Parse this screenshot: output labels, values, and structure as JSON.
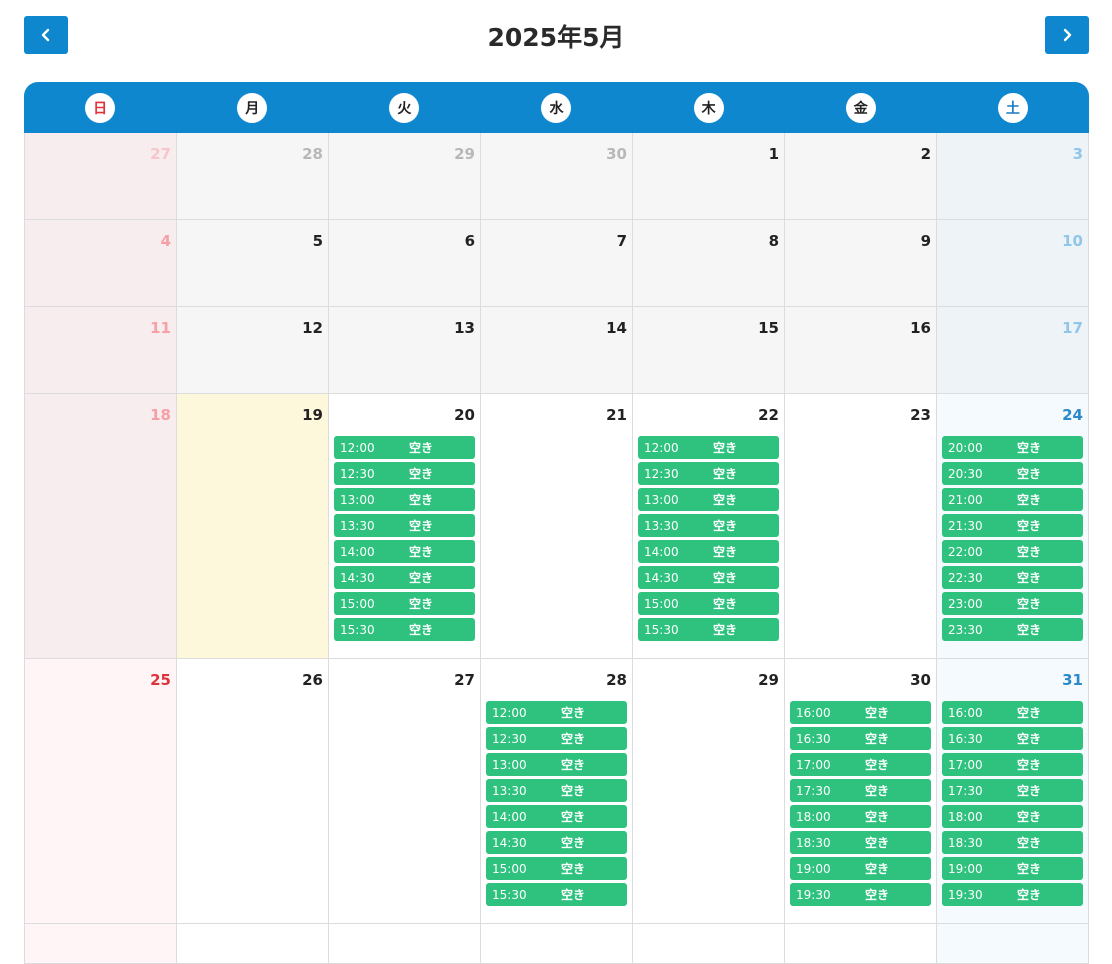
{
  "header": {
    "title": "2025年5月"
  },
  "weekdays": [
    {
      "label": "日"
    },
    {
      "label": "月"
    },
    {
      "label": "火"
    },
    {
      "label": "水"
    },
    {
      "label": "木"
    },
    {
      "label": "金"
    },
    {
      "label": "土"
    }
  ],
  "slot_status": "空き",
  "weeks": [
    [
      {
        "day": "27",
        "other": true,
        "past": true
      },
      {
        "day": "28",
        "other": true,
        "past": true
      },
      {
        "day": "29",
        "other": true,
        "past": true
      },
      {
        "day": "30",
        "other": true,
        "past": true
      },
      {
        "day": "1",
        "past": true
      },
      {
        "day": "2",
        "past": true
      },
      {
        "day": "3",
        "past": true
      }
    ],
    [
      {
        "day": "4",
        "past": true
      },
      {
        "day": "5",
        "past": true
      },
      {
        "day": "6",
        "past": true
      },
      {
        "day": "7",
        "past": true
      },
      {
        "day": "8",
        "past": true
      },
      {
        "day": "9",
        "past": true
      },
      {
        "day": "10",
        "past": true
      }
    ],
    [
      {
        "day": "11",
        "past": true
      },
      {
        "day": "12",
        "past": true
      },
      {
        "day": "13",
        "past": true
      },
      {
        "day": "14",
        "past": true
      },
      {
        "day": "15",
        "past": true
      },
      {
        "day": "16",
        "past": true
      },
      {
        "day": "17",
        "past": true
      }
    ],
    [
      {
        "day": "18",
        "past": true
      },
      {
        "day": "19",
        "today": true
      },
      {
        "day": "20",
        "slots": [
          "12:00",
          "12:30",
          "13:00",
          "13:30",
          "14:00",
          "14:30",
          "15:00",
          "15:30"
        ]
      },
      {
        "day": "21"
      },
      {
        "day": "22",
        "slots": [
          "12:00",
          "12:30",
          "13:00",
          "13:30",
          "14:00",
          "14:30",
          "15:00",
          "15:30"
        ]
      },
      {
        "day": "23"
      },
      {
        "day": "24",
        "slots": [
          "20:00",
          "20:30",
          "21:00",
          "21:30",
          "22:00",
          "22:30",
          "23:00",
          "23:30"
        ]
      }
    ],
    [
      {
        "day": "25"
      },
      {
        "day": "26"
      },
      {
        "day": "27"
      },
      {
        "day": "28",
        "slots": [
          "12:00",
          "12:30",
          "13:00",
          "13:30",
          "14:00",
          "14:30",
          "15:00",
          "15:30"
        ]
      },
      {
        "day": "29"
      },
      {
        "day": "30",
        "slots": [
          "16:00",
          "16:30",
          "17:00",
          "17:30",
          "18:00",
          "18:30",
          "19:00",
          "19:30"
        ]
      },
      {
        "day": "31",
        "slots": [
          "16:00",
          "16:30",
          "17:00",
          "17:30",
          "18:00",
          "18:30",
          "19:00",
          "19:30"
        ]
      }
    ],
    [
      {
        "day": ""
      },
      {
        "day": ""
      },
      {
        "day": ""
      },
      {
        "day": ""
      },
      {
        "day": ""
      },
      {
        "day": ""
      },
      {
        "day": ""
      }
    ]
  ]
}
